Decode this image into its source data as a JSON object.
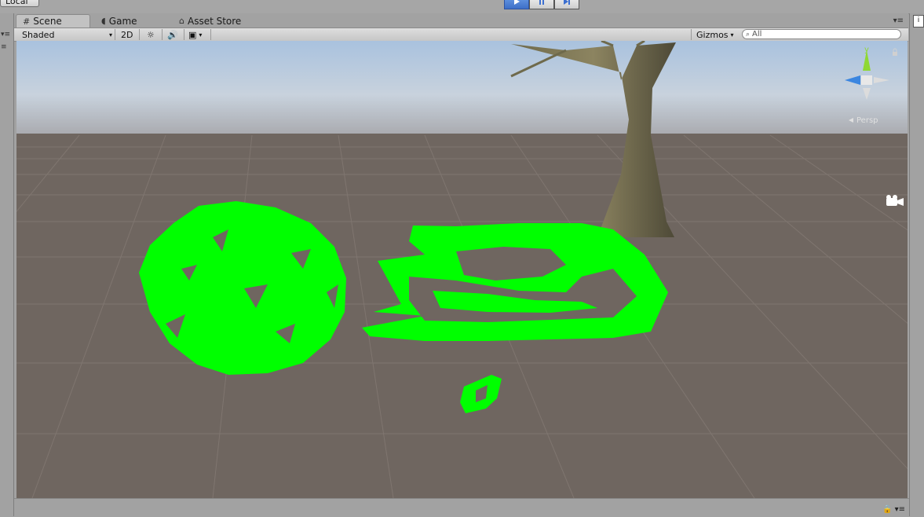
{
  "top_toolbar": {
    "pivot_rotation_label": "Local"
  },
  "play_controls": {
    "play": "play-icon",
    "pause": "pause-icon",
    "step": "step-icon",
    "accent": "#3d6fc8"
  },
  "tabs": [
    {
      "label": "Scene",
      "icon": "scene-grid-icon",
      "selected": true
    },
    {
      "label": "Game",
      "icon": "game-pacman-icon",
      "selected": false
    },
    {
      "label": "Asset Store",
      "icon": "store-icon",
      "selected": false
    }
  ],
  "scene_toolbar": {
    "render_mode": "Shaded",
    "mode_2d": "2D",
    "gizmos": "Gizmos",
    "search_placeholder": "All"
  },
  "scene_gizmo": {
    "y_label": "y",
    "projection_label": "Persp",
    "y_color": "#8fd832",
    "x_color": "#3b86e0"
  },
  "scene_objects": {
    "blob_color": "#00ff00",
    "ground_color": "#6f6660"
  }
}
